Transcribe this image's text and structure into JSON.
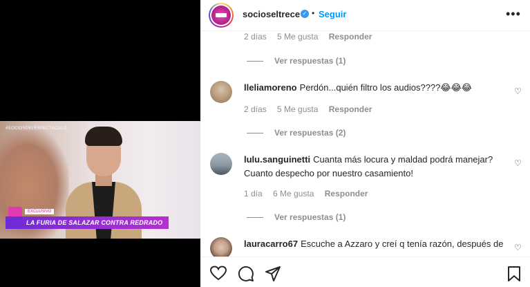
{
  "video": {
    "hashtag": "#SOCIOSDELESPECTACULO",
    "badge": "EXCLUSIVO",
    "headline": "LA FURIA DE SALAZAR CONTRA REDRADO"
  },
  "header": {
    "username": "socioseltrece",
    "follow_label": "Seguir",
    "more_label": "•••"
  },
  "partial_meta": {
    "time": "2 días",
    "likes": "5 Me gusta",
    "reply": "Responder"
  },
  "view_replies": [
    "Ver respuestas (1)",
    "Ver respuestas (2)",
    "Ver respuestas (1)"
  ],
  "comments": [
    {
      "user": "lleliamoreno",
      "text": "Perdón...quién filtro los audios????😂😂😂",
      "time": "2 días",
      "likes": "5 Me gusta",
      "reply": "Responder"
    },
    {
      "user": "lulu.sanguinetti",
      "text": "Cuanta más locura y maldad podrá manejar? Cuanto despecho por nuestro casamiento!",
      "time": "1 día",
      "likes": "6 Me gusta",
      "reply": "Responder"
    },
    {
      "user": "lauracarro67",
      "text": "Escuche a Azzaro y creí q tenía razón, después de"
    }
  ],
  "icons": {
    "heart": "heart-icon",
    "comment": "comment-icon",
    "share": "share-icon",
    "bookmark": "bookmark-icon",
    "verified": "verified-badge-icon"
  },
  "colors": {
    "accent": "#0095f6",
    "muted": "#8e8e8e",
    "text": "#262626"
  }
}
